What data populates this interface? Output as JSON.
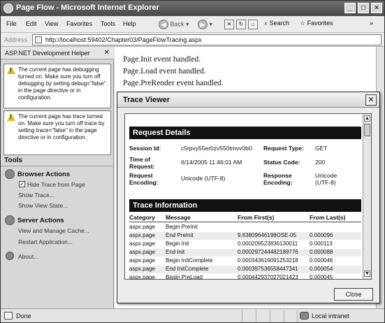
{
  "window": {
    "title": "Page Flow - Microsoft Internet Explorer"
  },
  "menu": {
    "items": [
      "File",
      "Edit",
      "View",
      "Favorites",
      "Tools",
      "Help"
    ],
    "back_label": "Back",
    "search_label": "Search",
    "favorites_label": "Favorites"
  },
  "address": {
    "label": "Address",
    "url": "http://localhost:59402/Chapter03/PageFlowTracing.aspx"
  },
  "sidebar": {
    "title": "ASP.NET Development Helper",
    "notices": [
      "The current page has debugging turned on. Make sure you turn off debugging by setting debug=\"false\" in the page directive or in configuration.",
      "The current page has trace turned on. Make sure you turn off trace by setting trace=\"false\" in the page directive or in configuration."
    ],
    "tools_label": "Tools",
    "browser_actions": {
      "title": "Browser Actions",
      "hide_trace": "Hide Trace from Page",
      "show_trace": "Show Trace...",
      "show_view_state": "Show View State..."
    },
    "server_actions": {
      "title": "Server Actions",
      "view_cache": "View and Manage Cache...",
      "restart": "Restart Application..."
    },
    "about": "About..."
  },
  "content": {
    "lines": [
      "Page.Init event handled.",
      "Page.Load event handled.",
      "Page.PreRender event handled."
    ]
  },
  "trace_viewer": {
    "title": "Trace Viewer",
    "request_details": {
      "heading": "Request Details",
      "session_id_label": "Session Id:",
      "session_id": "c5rpvy55er0zv550tmvv0b0",
      "request_type_label": "Request Type:",
      "request_type": "GET",
      "time_label": "Time of Request:",
      "time": "6/14/2005 11:46:01 AM",
      "status_label": "Status Code:",
      "status": "200",
      "req_enc_label": "Request Encoding:",
      "req_enc": "Unicode (UTF-8)",
      "resp_enc_label": "Response Encoding:",
      "resp_enc": "Unicode (UTF-8)"
    },
    "trace_information": {
      "heading": "Trace Information",
      "columns": [
        "Category",
        "Message",
        "From First(s)",
        "From Last(s)"
      ],
      "rows": [
        [
          "aspx.page",
          "Begin PreInit",
          "",
          ""
        ],
        [
          "aspx.page",
          "End PreInit",
          "9.63809646198OSE-05",
          "0.000096"
        ],
        [
          "aspx.page",
          "Begin Init",
          "0.000209523836130011",
          "0.000113"
        ],
        [
          "aspx.page",
          "End Init",
          "0.000297244482189776",
          "0.000088"
        ],
        [
          "aspx.page",
          "Begin InitComplete",
          "0.000343619091253218",
          "0.000046"
        ],
        [
          "aspx.page",
          "End InitComplete",
          "0.000397536558447341",
          "0.000054"
        ],
        [
          "aspx.page",
          "Begin PreLoad",
          "0.000442937027021423",
          "0.000045"
        ]
      ]
    },
    "close_label": "Close"
  },
  "status": {
    "text": "Done",
    "zone": "Local intranet"
  }
}
